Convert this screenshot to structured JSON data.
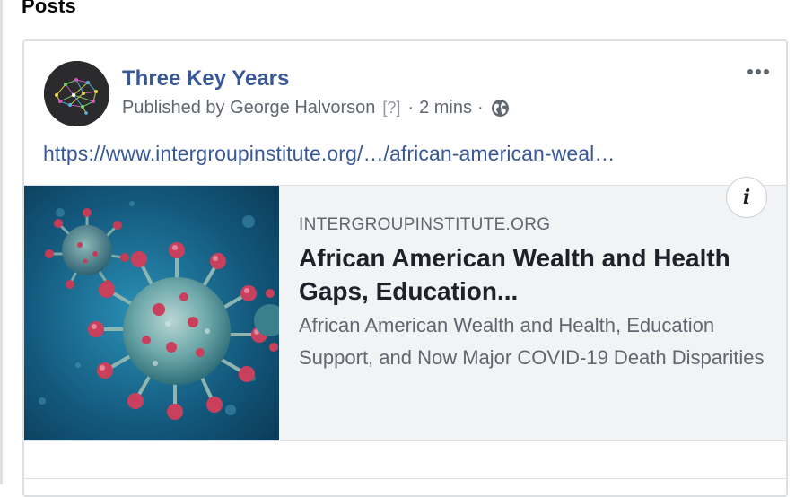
{
  "section": {
    "title": "Posts"
  },
  "post": {
    "page_name": "Three Key Years",
    "meta": {
      "published_by": "Published by George Halvorson",
      "help_marker": "[?]",
      "separator": "·",
      "time": "2 mins",
      "audience_icon": "globe-icon"
    },
    "menu_icon": "more-options-icon",
    "link_text": "https://www.intergroupinstitute.org/…/african-american-weal…",
    "preview": {
      "domain": "INTERGROUPINSTITUTE.ORG",
      "headline": "African American Wealth and Health Gaps, Education...",
      "description": "African American Wealth and Health, Education Support, and Now Major COVID-19 Death Disparities",
      "info_icon": "info-icon",
      "image": "coronavirus-image"
    }
  },
  "colors": {
    "link": "#385898",
    "secondary_text": "#606770",
    "preview_bg": "#f2f3f5",
    "border": "#dddfe2"
  }
}
